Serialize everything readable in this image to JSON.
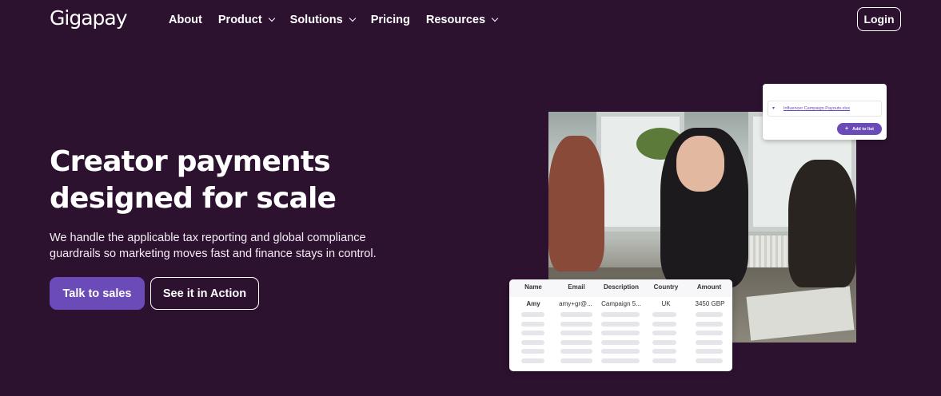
{
  "nav": {
    "logo": "Gigapay",
    "items": [
      {
        "label": "About",
        "dropdown": false
      },
      {
        "label": "Product",
        "dropdown": true
      },
      {
        "label": "Solutions",
        "dropdown": true
      },
      {
        "label": "Pricing",
        "dropdown": false
      },
      {
        "label": "Resources",
        "dropdown": true
      }
    ],
    "login_label": "Login"
  },
  "hero": {
    "title_line1": "Creator payments",
    "title_line2": "designed for scale",
    "subtitle_line1": "We handle the applicable tax reporting and global compliance",
    "subtitle_line2": "guardrails so marketing moves fast and finance stays in control.",
    "primary_cta": "Talk to sales",
    "secondary_cta": "See it in Action"
  },
  "upload_card": {
    "file_name": "Influencer Campaign Payouts.xlsx",
    "add_button": "Add to list",
    "add_icon": "plus-icon"
  },
  "payout_table": {
    "columns": [
      "Name",
      "Email",
      "Description",
      "Country",
      "Amount"
    ],
    "first_row": [
      "Amy",
      "amy+gr@...",
      "Campaign 5...",
      "UK",
      "3450 GBP"
    ]
  },
  "colors": {
    "background": "#2d1230",
    "accent": "#6b4bb8",
    "text": "#ffffff"
  }
}
